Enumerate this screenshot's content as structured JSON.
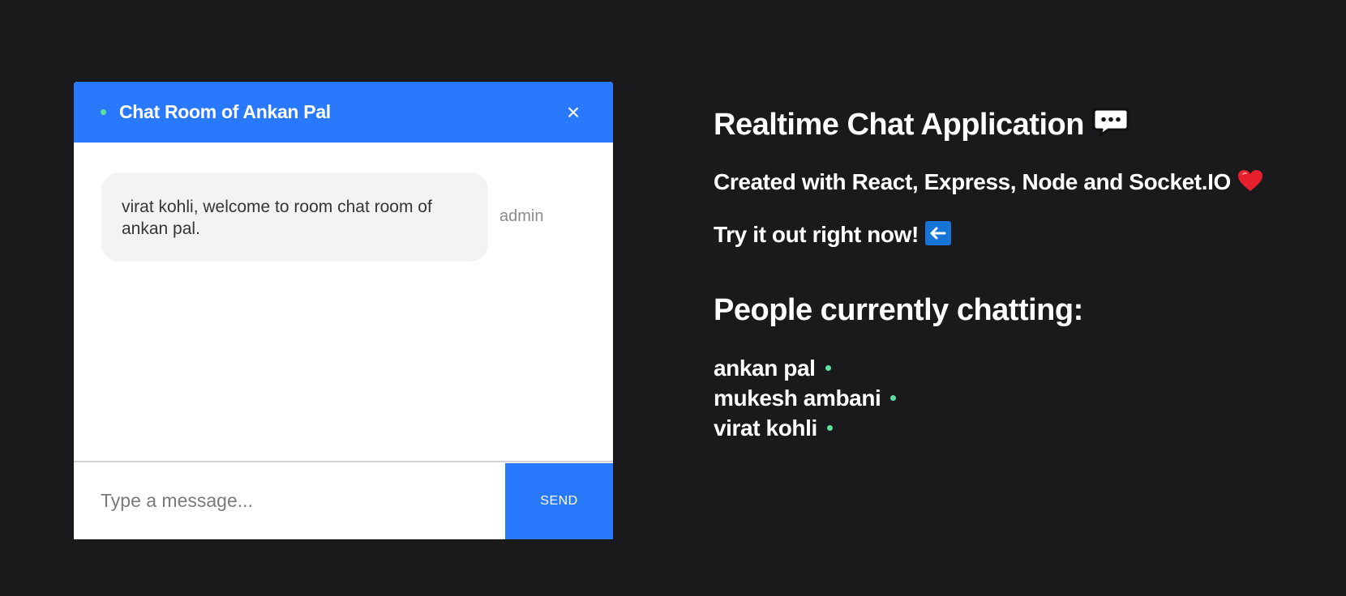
{
  "chat": {
    "title": "Chat Room of Ankan Pal",
    "close_label": "×",
    "messages": [
      {
        "text": "virat kohli, welcome to room chat room of ankan pal.",
        "sender": "admin"
      }
    ],
    "input_placeholder": "Type a message...",
    "input_value": "",
    "send_label": "SEND"
  },
  "info": {
    "title": "Realtime Chat Application",
    "subtitle": "Created with React, Express, Node and Socket.IO",
    "try_text": "Try it out right now!",
    "people_heading": "People currently chatting:",
    "people": [
      "ankan pal",
      "mukesh ambani",
      "virat kohli"
    ]
  },
  "icons": {
    "online_status": "online-dot-icon",
    "chat": "speech-bubble-icon",
    "heart": "heart-icon",
    "arrow": "left-arrow-icon"
  },
  "colors": {
    "background": "#1a1a1d",
    "accent": "#2979ff",
    "online": "#5ee1a0",
    "bubble": "#f3f3f3"
  }
}
